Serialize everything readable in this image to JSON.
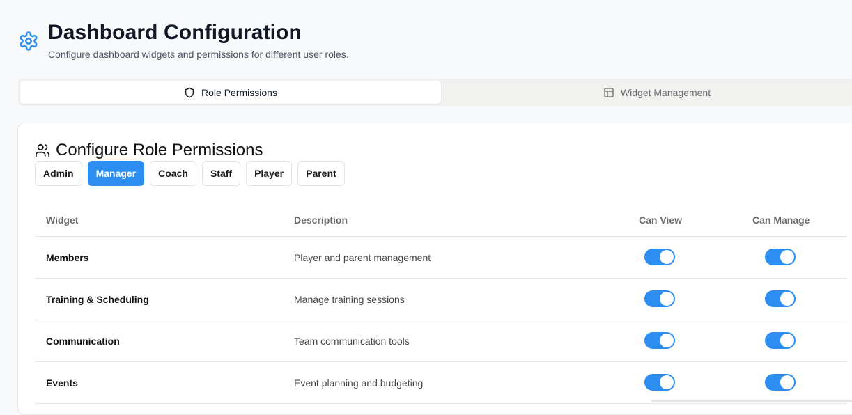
{
  "header": {
    "title": "Dashboard Configuration",
    "subtitle": "Configure dashboard widgets and permissions for different user roles.",
    "icon": "gear-icon"
  },
  "tabs": [
    {
      "label": "Role Permissions",
      "icon": "shield-icon",
      "active": true
    },
    {
      "label": "Widget Management",
      "icon": "layout-icon",
      "active": false
    }
  ],
  "card": {
    "title": "Configure Role Permissions",
    "icon": "users-icon"
  },
  "roles": [
    {
      "label": "Admin",
      "selected": false
    },
    {
      "label": "Manager",
      "selected": true
    },
    {
      "label": "Coach",
      "selected": false
    },
    {
      "label": "Staff",
      "selected": false
    },
    {
      "label": "Player",
      "selected": false
    },
    {
      "label": "Parent",
      "selected": false
    }
  ],
  "table": {
    "columns": [
      "Widget",
      "Description",
      "Can View",
      "Can Manage"
    ],
    "rows": [
      {
        "widget": "Members",
        "description": "Player and parent management",
        "can_view": true,
        "can_manage": true
      },
      {
        "widget": "Training & Scheduling",
        "description": "Manage training sessions",
        "can_view": true,
        "can_manage": true
      },
      {
        "widget": "Communication",
        "description": "Team communication tools",
        "can_view": true,
        "can_manage": true
      },
      {
        "widget": "Events",
        "description": "Event planning and budgeting",
        "can_view": true,
        "can_manage": true
      }
    ]
  },
  "colors": {
    "accent": "#2b8ef0",
    "background": "#f8f9fb",
    "card": "#ffffff"
  }
}
